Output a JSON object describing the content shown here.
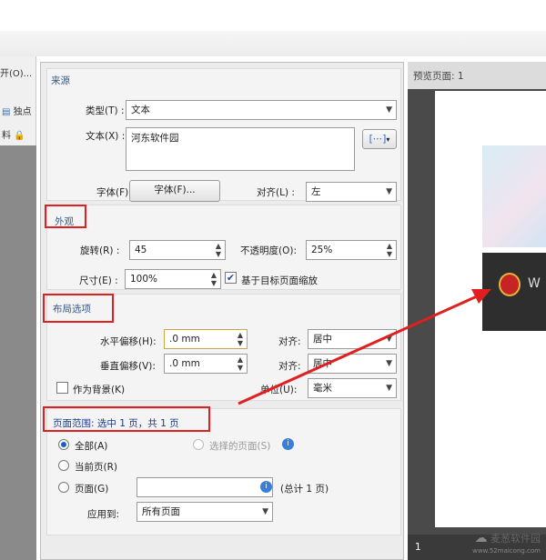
{
  "menu": {
    "open_label": "开(O)...",
    "toolbar_item": "独点",
    "side_item": "料"
  },
  "source": {
    "section_title": "来源",
    "type_label": "类型(T) :",
    "type_value": "文本",
    "text_label": "文本(X) :",
    "text_value": "河东软件园",
    "font_label": "字体(F):",
    "font_button": "字体(F)...",
    "align_label": "对齐(L) :",
    "align_value": "左"
  },
  "appearance": {
    "section_title": "外观",
    "rotate_label": "旋转(R) :",
    "rotate_value": "45",
    "opacity_label": "不透明度(O):",
    "opacity_value": "25%",
    "size_label": "尺寸(E) :",
    "size_value": "100%",
    "scale_checkbox_label": "基于目标页面缩放",
    "scale_checked": "✔"
  },
  "layout": {
    "section_title": "布局选项",
    "hoffset_label": "水平偏移(H):",
    "hoffset_value": ".0 mm",
    "voffset_label": "垂直偏移(V):",
    "voffset_value": ".0 mm",
    "halign_label": "对齐:",
    "halign_value": "居中",
    "valign_label": "对齐:",
    "valign_value": "居中",
    "unit_label": "单位(U):",
    "unit_value": "毫米",
    "background_label": "作为背景(K)"
  },
  "page_range": {
    "title": "页面范围: 选中 1 页，共 1 页",
    "all_label": "全部(A)",
    "selected_label": "选择的页面(S)",
    "current_label": "当前页(R)",
    "pages_label": "页面(G)",
    "pages_value": "",
    "total_label": "(总计 1 页)",
    "apply_label": "应用到:",
    "apply_value": "所有页面"
  },
  "preview": {
    "header": "预览页面: 1",
    "page_number": "1",
    "card_text": "W"
  },
  "watermark": {
    "name": "麦葱软件园",
    "url": "www.52maicong.com"
  },
  "colors": {
    "annotation_red": "#e02020",
    "radio_blue": "#1a5fc8"
  }
}
